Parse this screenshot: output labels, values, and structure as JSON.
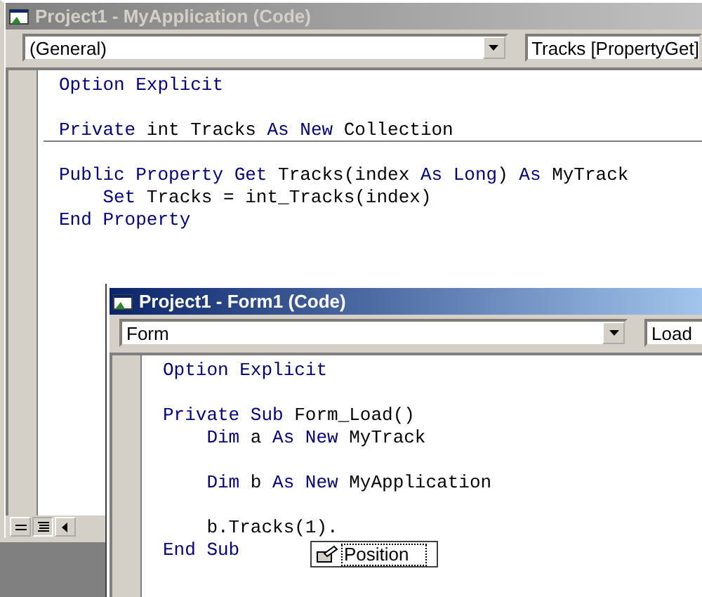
{
  "windows": [
    {
      "title": "Project1 - MyApplication (Code)",
      "active": false,
      "object_box": "(General)",
      "procedure_box": "Tracks [PropertyGet]",
      "lines": [
        {
          "kind": "code",
          "tokens": [
            {
              "kind": "keyword",
              "text": "Option Explicit"
            }
          ]
        },
        {
          "kind": "blank"
        },
        {
          "kind": "code",
          "separator": true,
          "tokens": [
            {
              "kind": "keyword",
              "text": "Private"
            },
            {
              "kind": "text",
              "text": " int Tracks "
            },
            {
              "kind": "keyword",
              "text": "As New"
            },
            {
              "kind": "text",
              "text": " Collection"
            }
          ]
        },
        {
          "kind": "blank"
        },
        {
          "kind": "code",
          "tokens": [
            {
              "kind": "keyword",
              "text": "Public Property Get"
            },
            {
              "kind": "text",
              "text": " Tracks(index "
            },
            {
              "kind": "keyword",
              "text": "As Long"
            },
            {
              "kind": "text",
              "text": ") "
            },
            {
              "kind": "keyword",
              "text": "As"
            },
            {
              "kind": "text",
              "text": " MyTrack"
            }
          ]
        },
        {
          "kind": "code",
          "tokens": [
            {
              "kind": "keyword",
              "text": "    Set"
            },
            {
              "kind": "text",
              "text": " Tracks = int_Tracks(index)"
            }
          ]
        },
        {
          "kind": "code",
          "tokens": [
            {
              "kind": "keyword",
              "text": "End Property"
            }
          ]
        }
      ]
    },
    {
      "title": "Project1 - Form1 (Code)",
      "active": true,
      "object_box": "Form",
      "procedure_box": "Load",
      "lines": [
        {
          "kind": "code",
          "tokens": [
            {
              "kind": "keyword",
              "text": "Option Explicit"
            }
          ]
        },
        {
          "kind": "blank"
        },
        {
          "kind": "code",
          "tokens": [
            {
              "kind": "keyword",
              "text": "Private Sub"
            },
            {
              "kind": "text",
              "text": " Form_Load()"
            }
          ]
        },
        {
          "kind": "code",
          "tokens": [
            {
              "kind": "keyword",
              "text": "    Dim"
            },
            {
              "kind": "text",
              "text": " a "
            },
            {
              "kind": "keyword",
              "text": "As New"
            },
            {
              "kind": "text",
              "text": " MyTrack"
            }
          ]
        },
        {
          "kind": "blank"
        },
        {
          "kind": "code",
          "tokens": [
            {
              "kind": "keyword",
              "text": "    Dim"
            },
            {
              "kind": "text",
              "text": " b "
            },
            {
              "kind": "keyword",
              "text": "As New"
            },
            {
              "kind": "text",
              "text": " MyApplication"
            }
          ]
        },
        {
          "kind": "blank"
        },
        {
          "kind": "code",
          "tokens": [
            {
              "kind": "text",
              "text": "    b.Tracks(1)."
            }
          ]
        },
        {
          "kind": "code",
          "tokens": [
            {
              "kind": "keyword",
              "text": "End Sub"
            }
          ]
        }
      ]
    }
  ],
  "autocomplete": {
    "items": [
      {
        "label": "Position"
      }
    ]
  }
}
